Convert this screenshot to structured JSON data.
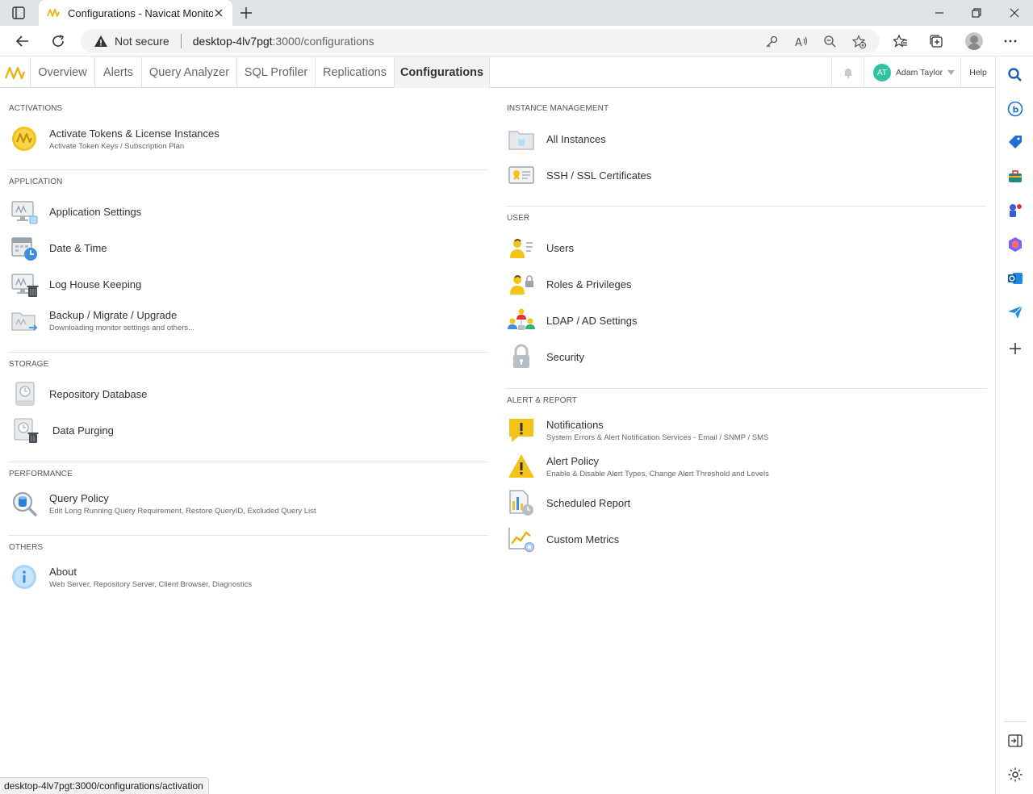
{
  "browser": {
    "tab_title": "Configurations - Navicat Monitor",
    "security_label": "Not secure",
    "url_host": "desktop-4lv7pgt",
    "url_path": ":3000/configurations",
    "status_url": "desktop-4lv7pgt:3000/configurations/activation"
  },
  "nav": {
    "tabs": [
      {
        "label": "Overview"
      },
      {
        "label": "Alerts"
      },
      {
        "label": "Query Analyzer"
      },
      {
        "label": "SQL Profiler"
      },
      {
        "label": "Replications"
      },
      {
        "label": "Configurations"
      }
    ],
    "active_tab": "Configurations",
    "user_initials": "AT",
    "user_name": "Adam Taylor",
    "help_label": "Help"
  },
  "colors": {
    "accent_yellow": "#f4c31a",
    "avatar_green": "#2fc3a2",
    "icon_blue": "#4a90d9"
  },
  "left": {
    "activations": {
      "title": "ACTIVATIONS",
      "items": [
        {
          "label": "Activate Tokens & License Instances",
          "sub": "Activate Token Keys / Subscription Plan",
          "icon": "license-token-icon"
        }
      ]
    },
    "application": {
      "title": "APPLICATION",
      "items": [
        {
          "label": "Application Settings",
          "icon": "monitor-settings-icon"
        },
        {
          "label": "Date & Time",
          "icon": "calendar-clock-icon"
        },
        {
          "label": "Log House Keeping",
          "icon": "monitor-trash-icon"
        },
        {
          "label": "Backup / Migrate / Upgrade",
          "sub": "Downloading monitor settings and others...",
          "icon": "folder-backup-icon"
        }
      ]
    },
    "storage": {
      "title": "STORAGE",
      "items": [
        {
          "label": "Repository Database",
          "icon": "database-clock-icon"
        },
        {
          "label": "Data Purging",
          "icon": "database-trash-icon"
        }
      ]
    },
    "performance": {
      "title": "PERFORMANCE",
      "items": [
        {
          "label": "Query Policy",
          "sub": "Edit Long Running Query Requirement, Restore QueryID, Excluded Query List",
          "icon": "magnifier-database-icon"
        }
      ]
    },
    "others": {
      "title": "OTHERS",
      "items": [
        {
          "label": "About",
          "sub": "Web Server, Repository Server, Client Browser, Diagnostics",
          "icon": "info-icon"
        }
      ]
    }
  },
  "right": {
    "instance": {
      "title": "INSTANCE MANAGEMENT",
      "items": [
        {
          "label": "All Instances",
          "icon": "folder-instances-icon"
        },
        {
          "label": "SSH / SSL Certificates",
          "icon": "certificate-icon"
        }
      ]
    },
    "user": {
      "title": "USER",
      "items": [
        {
          "label": "Users",
          "icon": "user-list-icon"
        },
        {
          "label": "Roles & Privileges",
          "icon": "user-lock-icon"
        },
        {
          "label": "LDAP / AD Settings",
          "icon": "user-group-icon"
        },
        {
          "label": "Security",
          "icon": "padlock-icon"
        }
      ]
    },
    "alert": {
      "title": "ALERT & REPORT",
      "items": [
        {
          "label": "Notifications",
          "sub": "System Errors & Alert Notification Services - Email / SNMP / SMS",
          "icon": "notification-bubble-icon"
        },
        {
          "label": "Alert Policy",
          "sub": "Enable & Disable Alert Types, Change Alert Threshold and Levels",
          "icon": "warning-triangle-icon"
        },
        {
          "label": "Scheduled Report",
          "icon": "report-clock-icon"
        },
        {
          "label": "Custom Metrics",
          "icon": "chart-gear-icon"
        }
      ]
    }
  }
}
